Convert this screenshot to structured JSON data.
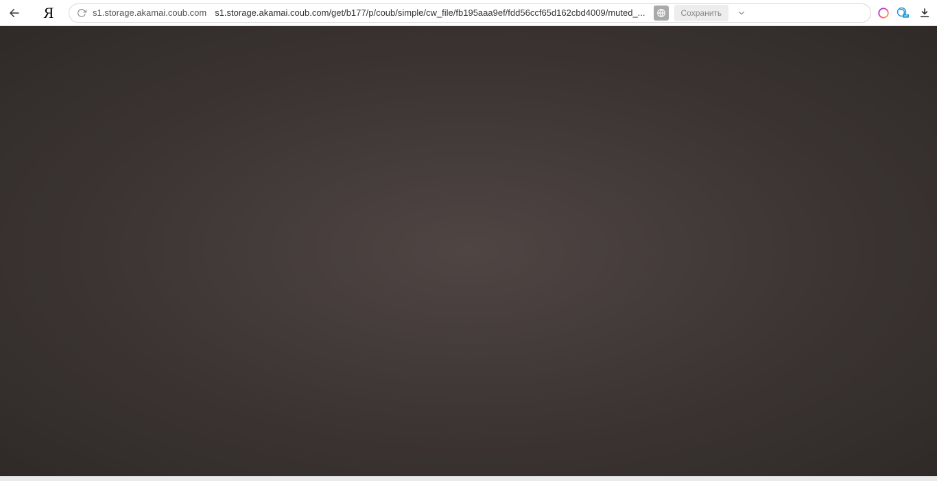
{
  "address": {
    "domain": "s1.storage.akamai.coub.com",
    "path": "s1.storage.akamai.coub.com/get/b177/p/coub/simple/cw_file/fb195aaa9ef/fdd56ccf65d162cbd4009/muted_..."
  },
  "toolbar": {
    "save_label": "Сохранить"
  }
}
